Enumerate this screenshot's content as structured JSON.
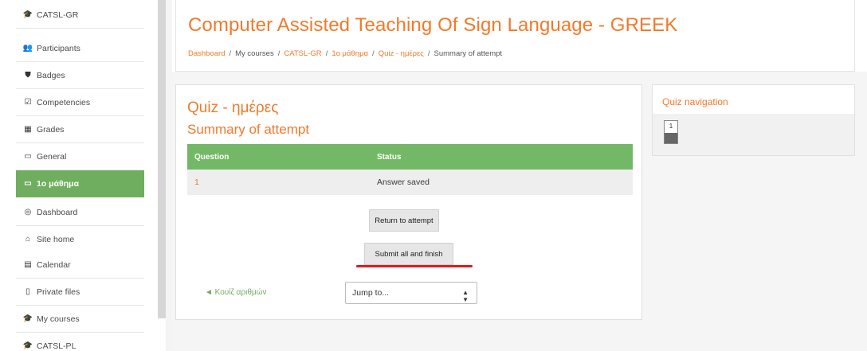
{
  "sidebar": {
    "items": [
      {
        "label": "CATSL-GR",
        "icon": "graduation-cap-icon",
        "glyph": "🎓"
      },
      {
        "label": "Participants",
        "icon": "users-icon",
        "glyph": "👥"
      },
      {
        "label": "Badges",
        "icon": "shield-icon",
        "glyph": "⛊"
      },
      {
        "label": "Competencies",
        "icon": "checkbox-icon",
        "glyph": "☑"
      },
      {
        "label": "Grades",
        "icon": "table-icon",
        "glyph": "▦"
      },
      {
        "label": "General",
        "icon": "folder-icon",
        "glyph": "▭"
      },
      {
        "label": "1ο μάθημα",
        "icon": "folder-icon",
        "glyph": "▭",
        "active": true
      },
      {
        "label": "Dashboard",
        "icon": "dashboard-icon",
        "glyph": "◎"
      },
      {
        "label": "Site home",
        "icon": "home-icon",
        "glyph": "⌂"
      },
      {
        "label": "Calendar",
        "icon": "calendar-icon",
        "glyph": "▤"
      },
      {
        "label": "Private files",
        "icon": "file-icon",
        "glyph": "▯"
      },
      {
        "label": "My courses",
        "icon": "graduation-cap-icon",
        "glyph": "🎓"
      },
      {
        "label": "CATSL-PL",
        "icon": "graduation-cap-icon",
        "glyph": "🎓"
      }
    ]
  },
  "header": {
    "title": "Computer Assisted Teaching Of Sign Language - GREEK",
    "breadcrumb": [
      "Dashboard",
      "My courses",
      "CATSL-GR",
      "1ο μάθημα",
      "Quiz - ημέρες",
      "Summary of attempt"
    ]
  },
  "main": {
    "quiz_title": "Quiz - ημέρες",
    "summary_title": "Summary of attempt",
    "table": {
      "headers": {
        "question": "Question",
        "status": "Status"
      },
      "rows": [
        {
          "question": "1",
          "status": "Answer saved"
        }
      ]
    },
    "return_button": "Return to attempt",
    "submit_button": "Submit all and finish",
    "prev_link": "◄ Κουίζ αριθμών",
    "jump_select": {
      "value": "Jump to..."
    }
  },
  "quiz_nav": {
    "title": "Quiz navigation",
    "buttons": [
      {
        "number": "1"
      }
    ]
  },
  "colors": {
    "accent_orange": "#f17a2a",
    "active_green": "#6fae5e",
    "table_header_green": "#73b866",
    "underline_red": "#e0191e"
  }
}
